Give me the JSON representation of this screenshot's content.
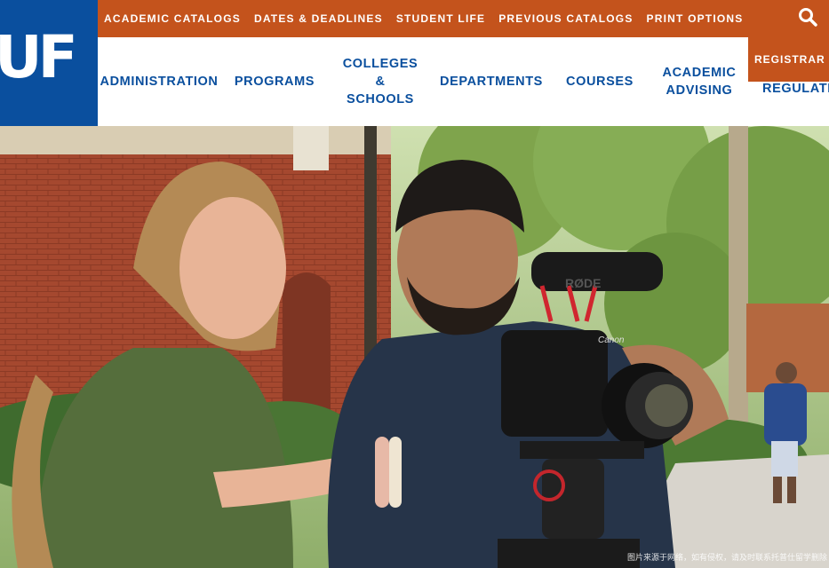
{
  "logo": {
    "text": "UF"
  },
  "topbar": {
    "links": [
      "ACADEMIC CATALOGS",
      "DATES & DEADLINES",
      "STUDENT LIFE",
      "PREVIOUS CATALOGS",
      "PRINT OPTIONS"
    ]
  },
  "mainnav": {
    "administration": "ADMINISTRATION",
    "programs": "PROGRAMS",
    "colleges_line1": "COLLEGES",
    "colleges_line2": "&",
    "colleges_line3": "SCHOOLS",
    "departments": "DEPARTMENTS",
    "courses": "COURSES",
    "advising_line1": "ACADEMIC",
    "advising_line2": "ADVISING",
    "registrar": "REGISTRAR",
    "regulations": "REGULATIONS"
  },
  "hero": {
    "camera_brand": "Canon",
    "mic_brand": "RØDE"
  },
  "watermark": "图片来源于网络，如有侵权，请及时联系托普仕留学删除",
  "colors": {
    "blue": "#0a4f9e",
    "orange": "#c4531c"
  },
  "icons": {
    "search": "search-icon"
  }
}
